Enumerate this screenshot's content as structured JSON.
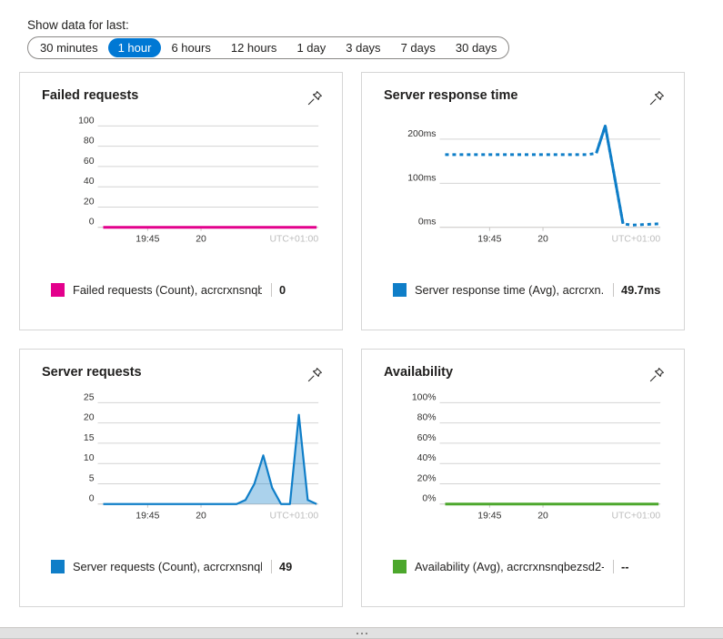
{
  "range_selector": {
    "label": "Show data for last:",
    "options": [
      {
        "label": "30 minutes",
        "selected": false
      },
      {
        "label": "1 hour",
        "selected": true
      },
      {
        "label": "6 hours",
        "selected": false
      },
      {
        "label": "12 hours",
        "selected": false
      },
      {
        "label": "1 day",
        "selected": false
      },
      {
        "label": "3 days",
        "selected": false
      },
      {
        "label": "7 days",
        "selected": false
      },
      {
        "label": "30 days",
        "selected": false
      }
    ]
  },
  "colors": {
    "accent": "#0078d4",
    "magenta": "#e3008c",
    "blue": "#0f7ec8",
    "green": "#4ca72c",
    "gridline": "#d4d4d4",
    "muted_text": "#bdbdbd"
  },
  "cards": [
    {
      "title": "Failed requests",
      "pin_icon": "pin-icon",
      "legend": {
        "label": "Failed requests (Count), acrcrxnsnqb...",
        "value": "0",
        "color": "#e3008c"
      }
    },
    {
      "title": "Server response time",
      "pin_icon": "pin-icon",
      "legend": {
        "label": "Server response time (Avg), acrcrxn...",
        "value": "49.7ms",
        "color": "#0f7ec8"
      }
    },
    {
      "title": "Server requests",
      "pin_icon": "pin-icon",
      "legend": {
        "label": "Server requests (Count), acrcrxnsnqb...",
        "value": "49",
        "color": "#0f7ec8"
      }
    },
    {
      "title": "Availability",
      "pin_icon": "pin-icon",
      "legend": {
        "label": "Availability (Avg), acrcrxnsnqbezsd2-...",
        "value": "--",
        "color": "#4ca72c"
      }
    }
  ],
  "chart_data": [
    {
      "type": "line",
      "title": "Failed requests",
      "ylabel": "",
      "xlabel": "",
      "timezone_note": "UTC+01:00",
      "yticks": [
        0,
        20,
        40,
        60,
        80,
        100
      ],
      "ytick_labels": [
        "0",
        "20",
        "40",
        "60",
        "80",
        "100"
      ],
      "ylim": [
        0,
        100
      ],
      "xtick_labels": [
        "19:45",
        "20"
      ],
      "grid": true,
      "series": [
        {
          "name": "Failed requests (Count)",
          "color": "#e3008c",
          "values": [
            0,
            0,
            0,
            0,
            0,
            0,
            0,
            0,
            0,
            0,
            0,
            0,
            0,
            0,
            0,
            0,
            0,
            0,
            0,
            0,
            0,
            0,
            0,
            0,
            0
          ]
        }
      ]
    },
    {
      "type": "line",
      "title": "Server response time",
      "ylabel": "",
      "xlabel": "",
      "timezone_note": "UTC+01:00",
      "yticks": [
        0,
        100,
        200
      ],
      "ytick_labels": [
        "0ms",
        "100ms",
        "200ms"
      ],
      "ylim": [
        0,
        230
      ],
      "xtick_labels": [
        "19:45",
        "20"
      ],
      "grid": true,
      "series": [
        {
          "name": "Server response time (Avg)",
          "color": "#0f7ec8",
          "values": [
            165,
            165,
            165,
            165,
            165,
            165,
            165,
            165,
            165,
            165,
            165,
            165,
            165,
            165,
            165,
            165,
            165,
            168,
            230,
            120,
            8,
            5,
            6,
            7,
            8
          ]
        }
      ]
    },
    {
      "type": "area",
      "title": "Server requests",
      "ylabel": "",
      "xlabel": "",
      "timezone_note": "UTC+01:00",
      "yticks": [
        0,
        5,
        10,
        15,
        20,
        25
      ],
      "ytick_labels": [
        "0",
        "5",
        "10",
        "15",
        "20",
        "25"
      ],
      "ylim": [
        0,
        25
      ],
      "xtick_labels": [
        "19:45",
        "20"
      ],
      "grid": true,
      "series": [
        {
          "name": "Server requests (Count)",
          "color": "#0f7ec8",
          "values": [
            0,
            0,
            0,
            0,
            0,
            0,
            0,
            0,
            0,
            0,
            0,
            0,
            0,
            0,
            0,
            0,
            1,
            5,
            12,
            4,
            0,
            0,
            22,
            1,
            0
          ]
        }
      ]
    },
    {
      "type": "line",
      "title": "Availability",
      "ylabel": "",
      "xlabel": "",
      "timezone_note": "UTC+01:00",
      "yticks": [
        0,
        20,
        40,
        60,
        80,
        100
      ],
      "ytick_labels": [
        "0%",
        "20%",
        "40%",
        "60%",
        "80%",
        "100%"
      ],
      "ylim": [
        0,
        100
      ],
      "xtick_labels": [
        "19:45",
        "20"
      ],
      "grid": true,
      "series": [
        {
          "name": "Availability (Avg)",
          "color": "#4ca72c",
          "values": [
            0,
            0,
            0,
            0,
            0,
            0,
            0,
            0,
            0,
            0,
            0,
            0,
            0,
            0,
            0,
            0,
            0,
            0,
            0,
            0,
            0,
            0,
            0,
            0,
            0
          ]
        }
      ]
    }
  ]
}
